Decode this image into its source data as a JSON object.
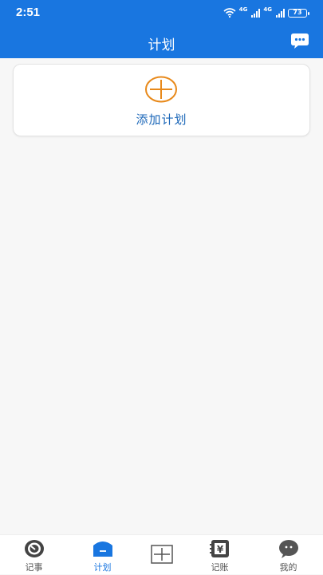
{
  "status_bar": {
    "time": "2:51",
    "network_1": "4G",
    "network_2": "4G",
    "battery": "73"
  },
  "header": {
    "title": "计划",
    "message_icon": "chat-bubble-icon"
  },
  "add_plan_card": {
    "label": "添加计划",
    "icon": "plus-circle-icon",
    "icon_color": "#e8891a"
  },
  "tabs": [
    {
      "label": "记事",
      "icon": "notebook-icon",
      "active": false
    },
    {
      "label": "计划",
      "icon": "plan-icon",
      "active": true
    },
    {
      "label": "",
      "icon": "add-square-icon",
      "active": false
    },
    {
      "label": "记账",
      "icon": "ledger-yen-icon",
      "active": false
    },
    {
      "label": "我的",
      "icon": "profile-face-icon",
      "active": false
    }
  ],
  "colors": {
    "primary": "#1976e0",
    "accent": "#e8891a",
    "background": "#f7f7f7"
  }
}
